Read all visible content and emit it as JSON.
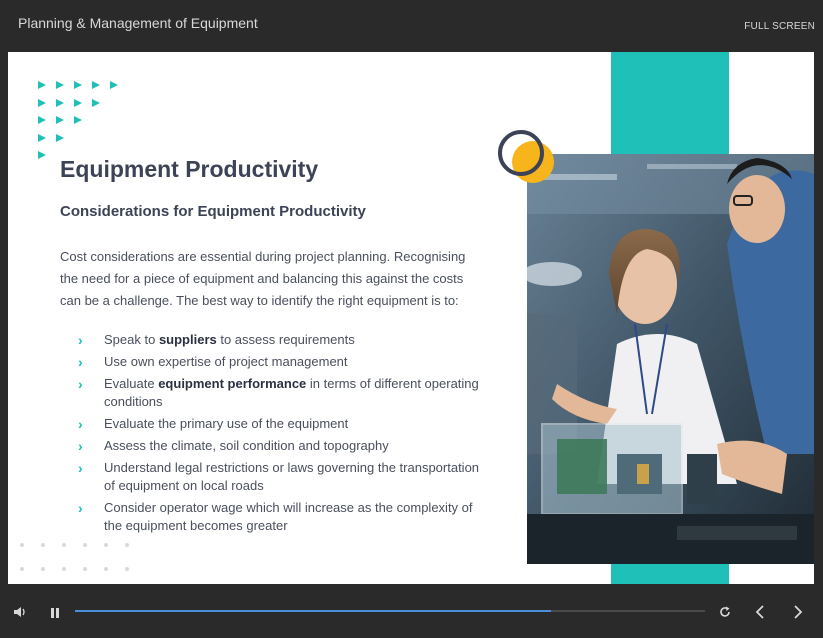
{
  "header": {
    "course_title": "Planning & Management of Equipment",
    "fullscreen_label": "FULL SCREEN"
  },
  "slide": {
    "heading": "Equipment Productivity",
    "subheading": "Considerations for Equipment Productivity",
    "intro": "Cost considerations are essential during project planning. Recognising the need for a piece of equipment and balancing this against the costs can be a challenge. The best way to identify the right equipment is to:",
    "bullets": [
      {
        "pre": "Speak to ",
        "bold": "suppliers",
        "post": " to assess requirements"
      },
      {
        "pre": "Use own expertise of project management",
        "bold": "",
        "post": ""
      },
      {
        "pre": "Evaluate ",
        "bold": "equipment performance",
        "post": " in terms of different operating conditions"
      },
      {
        "pre": "Evaluate the primary use of the equipment",
        "bold": "",
        "post": ""
      },
      {
        "pre": "Assess the climate, soil condition and topography",
        "bold": "",
        "post": ""
      },
      {
        "pre": "Understand legal restrictions or laws governing the transportation of equipment on local roads",
        "bold": "",
        "post": ""
      },
      {
        "pre": "Consider operator wage which will increase as the complexity of the equipment becomes greater",
        "bold": "",
        "post": ""
      }
    ],
    "accent_color": "#1ec0b7",
    "secondary_color": "#f7b51b",
    "text_color": "#3d4356"
  },
  "player": {
    "progress": 0.755,
    "icons": [
      "volume-icon",
      "pause-icon",
      "replay-icon",
      "prev-icon",
      "next-icon"
    ]
  }
}
